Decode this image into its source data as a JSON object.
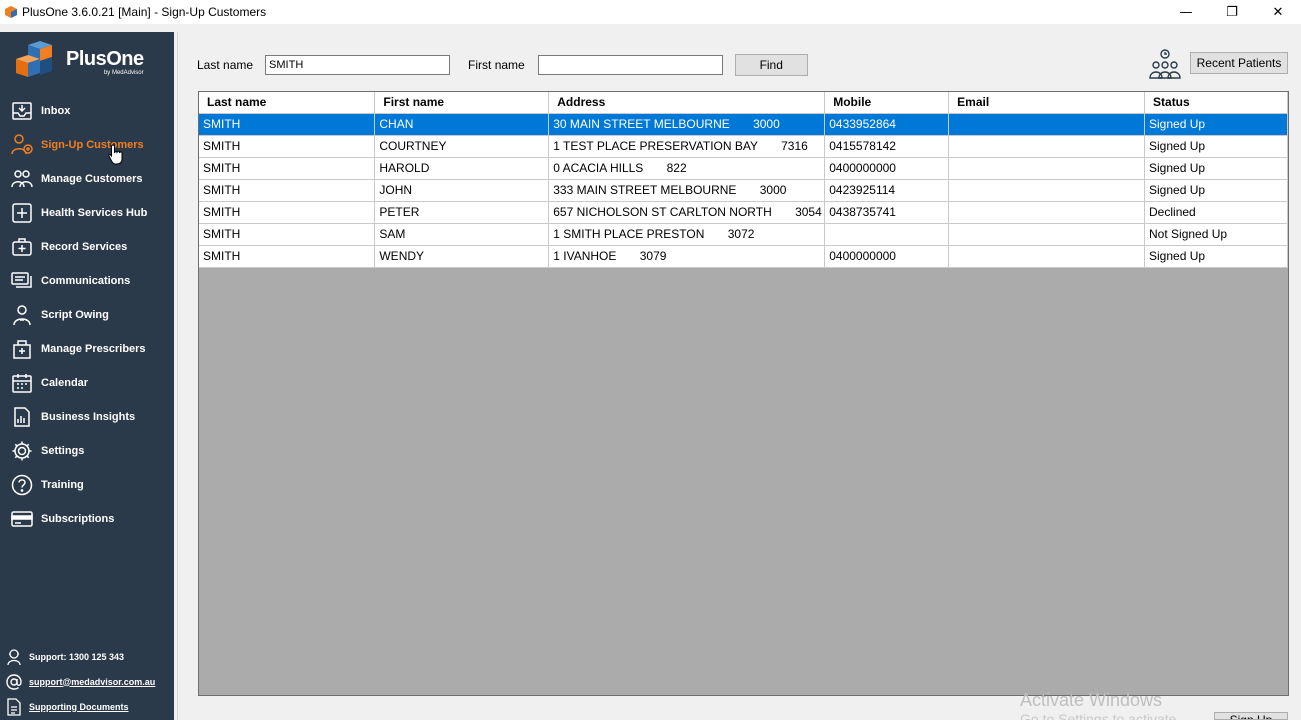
{
  "window": {
    "title": "PlusOne 3.6.0.21 [Main] - Sign-Up Customers",
    "minimize": "—",
    "restore": "❐",
    "close": "✕"
  },
  "brand": {
    "name": "PlusOne",
    "byline": "by MedAdvisor",
    "accent": "#f07f22",
    "sidebar_bg": "#2b3a4a",
    "selection": "#0078d7"
  },
  "nav": {
    "items": [
      {
        "label": "Inbox",
        "icon": "inbox-icon"
      },
      {
        "label": "Sign-Up Customers",
        "icon": "sign-up-icon",
        "active": true
      },
      {
        "label": "Manage Customers",
        "icon": "customers-icon"
      },
      {
        "label": "Health Services Hub",
        "icon": "health-hub-icon"
      },
      {
        "label": "Record Services",
        "icon": "record-services-icon"
      },
      {
        "label": "Communications",
        "icon": "communications-icon"
      },
      {
        "label": "Script Owing",
        "icon": "script-owing-icon"
      },
      {
        "label": "Manage Prescribers",
        "icon": "prescribers-icon"
      },
      {
        "label": "Calendar",
        "icon": "calendar-icon"
      },
      {
        "label": "Business Insights",
        "icon": "insights-icon"
      },
      {
        "label": "Settings",
        "icon": "gear-icon"
      },
      {
        "label": "Training",
        "icon": "help-icon"
      },
      {
        "label": "Subscriptions",
        "icon": "card-icon"
      }
    ]
  },
  "support": {
    "phone": "Support: 1300 125 343",
    "email": "support@medadvisor.com.au",
    "docs": "Supporting Documents"
  },
  "search": {
    "last_name_label": "Last name",
    "last_name_value": "SMITH",
    "first_name_label": "First name",
    "first_name_value": "",
    "find_label": "Find",
    "recent_label": "Recent Patients"
  },
  "table": {
    "columns": [
      "Last name",
      "First name",
      "Address",
      "Mobile",
      "Email",
      "Status"
    ],
    "rows": [
      [
        "SMITH",
        "CHAN",
        "30 MAIN STREET MELBOURNE       3000",
        "0433952864",
        "",
        "Signed Up"
      ],
      [
        "SMITH",
        "COURTNEY",
        "1 TEST PLACE PRESERVATION BAY       7316",
        "0415578142",
        "",
        "Signed Up"
      ],
      [
        "SMITH",
        "HAROLD",
        "0 ACACIA HILLS       822",
        "0400000000",
        "",
        "Signed Up"
      ],
      [
        "SMITH",
        "JOHN",
        "333 MAIN STREET MELBOURNE       3000",
        "0423925114",
        "",
        "Signed Up"
      ],
      [
        "SMITH",
        "PETER",
        "657 NICHOLSON ST CARLTON NORTH       3054",
        "0438735741",
        "",
        "Declined"
      ],
      [
        "SMITH",
        "SAM",
        "1 SMITH PLACE PRESTON       3072",
        "",
        "",
        "Not Signed Up"
      ],
      [
        "SMITH",
        "WENDY",
        "1 IVANHOE       3079",
        "0400000000",
        "",
        "Signed Up"
      ]
    ],
    "selected_index": 0
  },
  "overlay": {
    "activate": "Activate Windows",
    "activate_sub": "Go to Settings to activate Windows.",
    "signup_label": "Sign Up"
  }
}
